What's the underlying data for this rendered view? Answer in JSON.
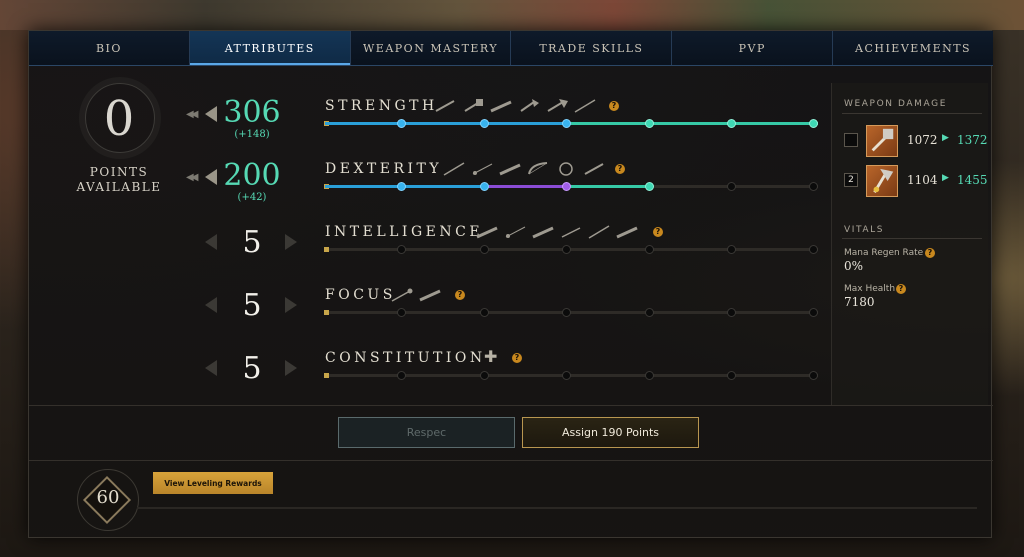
{
  "tabs": [
    {
      "label": "BIO",
      "active": false
    },
    {
      "label": "ATTRIBUTES",
      "active": true
    },
    {
      "label": "WEAPON MASTERY",
      "active": false
    },
    {
      "label": "TRADE SKILLS",
      "active": false
    },
    {
      "label": "PVP",
      "active": false
    },
    {
      "label": "ACHIEVEMENTS",
      "active": false
    }
  ],
  "points": {
    "value": "0",
    "label_line1": "POINTS",
    "label_line2": "AVAILABLE"
  },
  "attributes": [
    {
      "name": "STRENGTH",
      "value": "306",
      "bonus": "(+148)",
      "value_color": "green",
      "weapon_icons": [
        "sword-icon",
        "warhammer-icon",
        "musket-icon",
        "axe-icon",
        "great-axe-icon",
        "spear-icon"
      ]
    },
    {
      "name": "DEXTERITY",
      "value": "200",
      "bonus": "(+42)",
      "value_color": "green",
      "weapon_icons": [
        "spear-icon",
        "rapier-icon",
        "musket-icon",
        "bow-icon",
        "hatchet-icon",
        "sword-icon"
      ]
    },
    {
      "name": "INTELLIGENCE",
      "value": "5",
      "bonus": "",
      "value_color": "white",
      "weapon_icons": [
        "fire-staff-icon",
        "rapier-icon",
        "fire-staff-icon",
        "blunderbuss-icon",
        "spear-icon",
        "void-gauntlet-icon"
      ]
    },
    {
      "name": "FOCUS",
      "value": "5",
      "bonus": "",
      "value_color": "white",
      "weapon_icons": [
        "life-staff-icon",
        "ice-gauntlet-icon"
      ]
    },
    {
      "name": "CONSTITUTION",
      "value": "5",
      "bonus": "",
      "value_color": "white",
      "weapon_icons": []
    }
  ],
  "sidebar": {
    "weapon_damage_title": "WEAPON DAMAGE",
    "weapons": [
      {
        "slot": "",
        "from": "1072",
        "to": "1372",
        "icon": "warhammer-icon"
      },
      {
        "slot": "2",
        "from": "1104",
        "to": "1455",
        "icon": "great-axe-icon"
      }
    ],
    "vitals_title": "VITALS",
    "vitals": [
      {
        "label": "Mana Regen Rate",
        "value": "0%"
      },
      {
        "label": "Max Health",
        "value": "7180"
      }
    ]
  },
  "buttons": {
    "respec": "Respec",
    "assign": "Assign  190  Points",
    "rewards": "View Leveling Rewards"
  },
  "level": "60",
  "colors": {
    "accent_green": "#56d9b4",
    "accent_blue": "#2a9fd8",
    "accent_purple": "#8b4cd6",
    "gold": "#d8a33a"
  }
}
